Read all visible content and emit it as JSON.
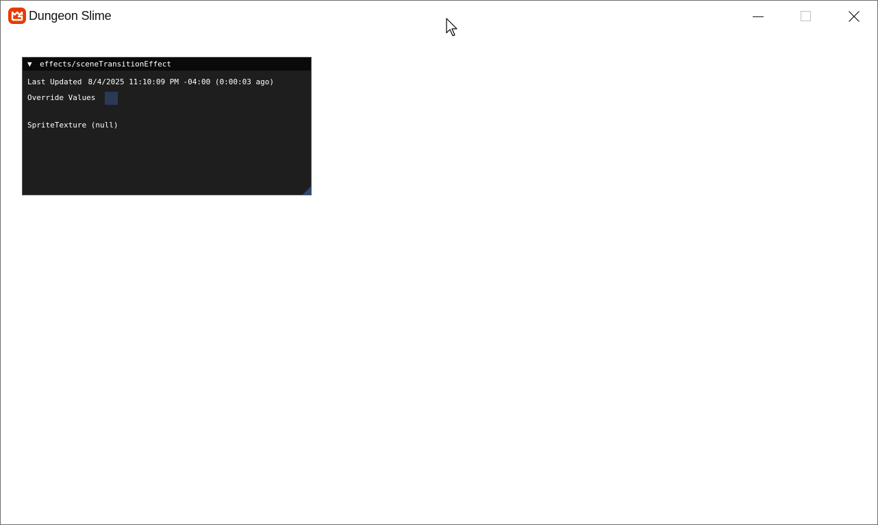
{
  "window": {
    "title": "Dungeon Slime",
    "icon": "monogame-logo-icon",
    "controls": {
      "minimize": "minimize-icon",
      "maximize": "maximize-icon",
      "close": "close-icon"
    }
  },
  "colors": {
    "app_icon": "#e73c00",
    "panel_bg": "#1e1e1e",
    "header_bg": "#0a0a0a",
    "checkbox_bg": "#2a3a55",
    "resize_grip": "#2c4a7a"
  },
  "panel": {
    "arrow": "▼",
    "title": "effects/sceneTransitionEffect",
    "last_updated_label": "Last Updated",
    "last_updated_value": "8/4/2025 11:10:09 PM -04:00 (0:00:03 ago)",
    "override_label": "Override Values",
    "override_checked": false,
    "sprite_texture_label": "SpriteTexture (null)"
  }
}
